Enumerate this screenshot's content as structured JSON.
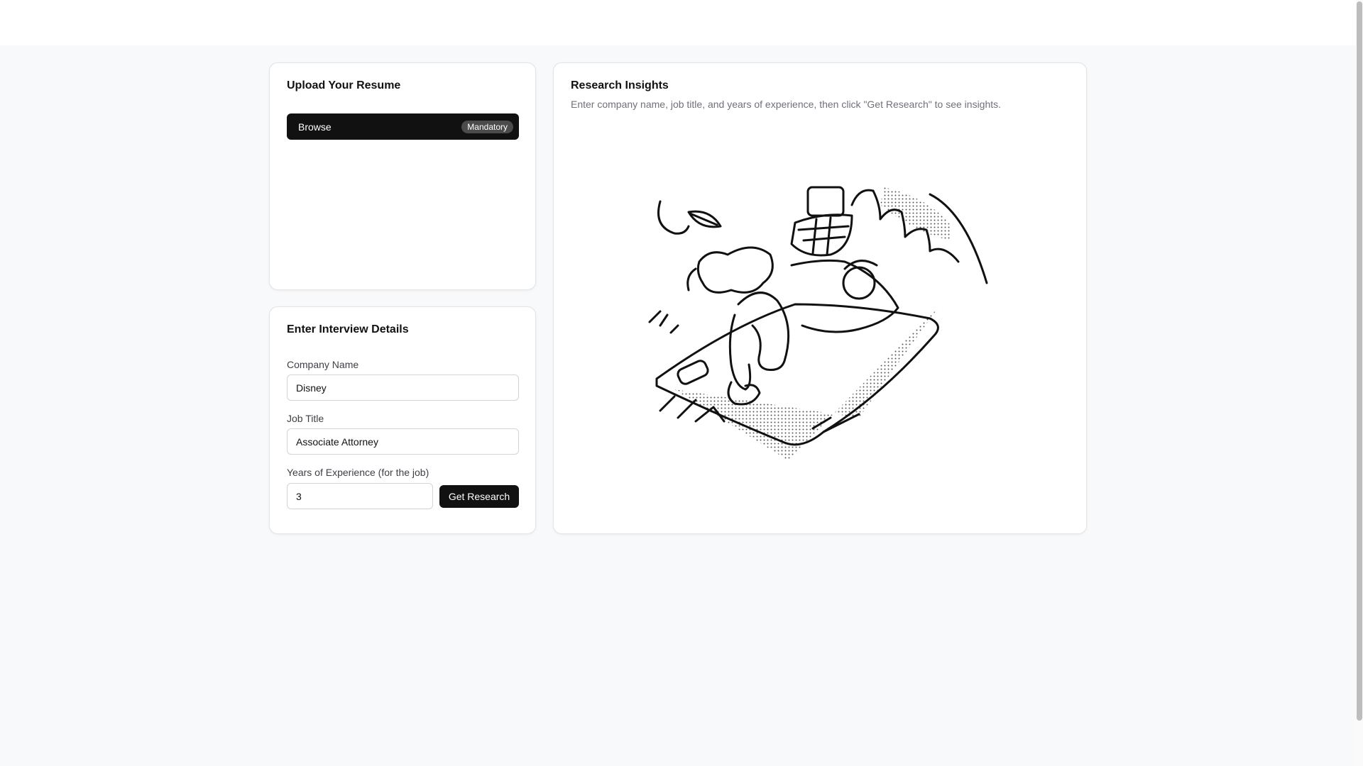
{
  "upload": {
    "title": "Upload Your Resume",
    "browse_label": "Browse",
    "badge": "Mandatory"
  },
  "details": {
    "title": "Enter Interview Details",
    "company_label": "Company Name",
    "company_value": "Disney",
    "job_label": "Job Title",
    "job_value": "Associate Attorney",
    "years_label": "Years of Experience (for the job)",
    "years_value": "3",
    "submit_label": "Get Research"
  },
  "research": {
    "title": "Research Insights",
    "subtitle": "Enter company name, job title, and years of experience, then click \"Get Research\" to see insights.",
    "illustration_icon": "picnic-relaxing-illustration"
  },
  "colors": {
    "background": "#f8f9fa",
    "primary": "#111111",
    "badge": "#4b4b4b",
    "muted_text": "#71717a"
  }
}
